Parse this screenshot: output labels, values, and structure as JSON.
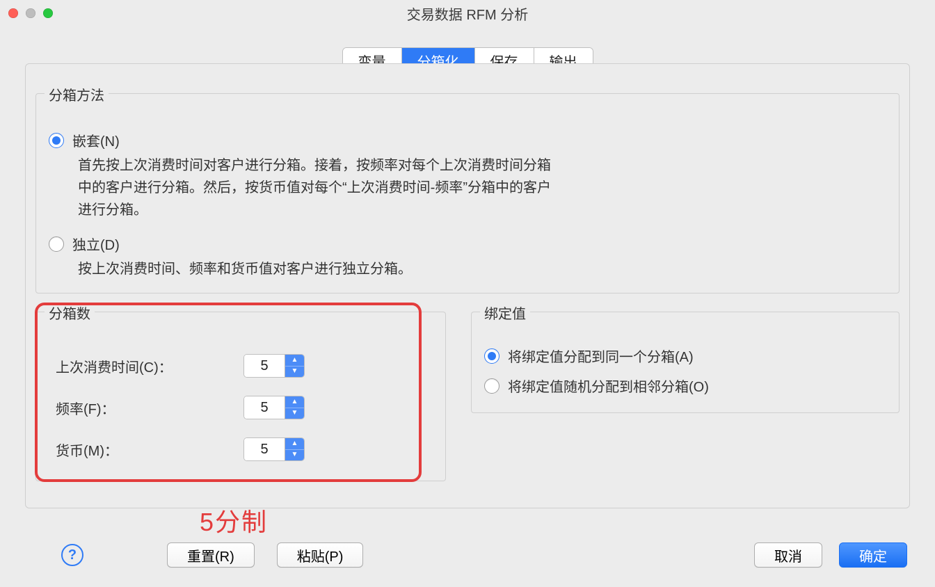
{
  "window": {
    "title": "交易数据 RFM 分析"
  },
  "tabs": {
    "variables": "变量",
    "binning": "分箱化",
    "save": "保存",
    "output": "输出",
    "active": "binning"
  },
  "method": {
    "legend": "分箱方法",
    "nested": {
      "label": "嵌套(N)",
      "desc": "首先按上次消费时间对客户进行分箱。接着，按频率对每个上次消费时间分箱中的客户进行分箱。然后，按货币值对每个“上次消费时间-频率”分箱中的客户进行分箱。"
    },
    "independent": {
      "label": "独立(D)",
      "desc": "按上次消费时间、频率和货币值对客户进行独立分箱。"
    },
    "selected": "nested"
  },
  "counts": {
    "legend": "分箱数",
    "recency": {
      "label": "上次消费时间(C)：",
      "value": "5"
    },
    "frequency": {
      "label": "频率(F)：",
      "value": "5"
    },
    "monetary": {
      "label": "货币(M)：",
      "value": "5"
    }
  },
  "ties": {
    "legend": "绑定值",
    "same": {
      "label": "将绑定值分配到同一个分箱(A)"
    },
    "random": {
      "label": "将绑定值随机分配到相邻分箱(O)"
    },
    "selected": "same"
  },
  "annotation": "5分制",
  "buttons": {
    "help": "?",
    "reset": "重置(R)",
    "paste": "粘贴(P)",
    "cancel": "取消",
    "ok": "确定"
  }
}
